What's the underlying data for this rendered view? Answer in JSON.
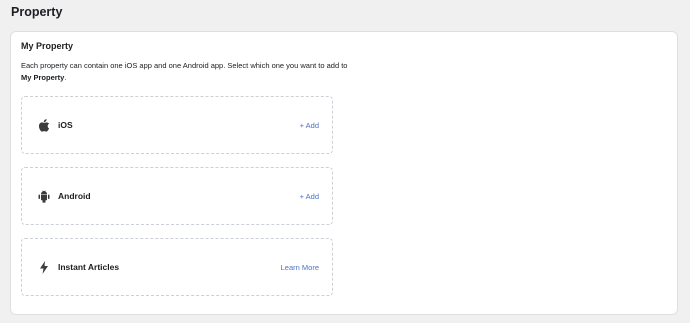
{
  "page": {
    "title": "Property"
  },
  "card": {
    "title": "My Property",
    "description_prefix": "Each property can contain one iOS app and one Android app. Select which one you want to add to ",
    "description_bold": "My Property",
    "description_suffix": "."
  },
  "platforms": [
    {
      "label": "iOS",
      "icon": "apple-icon",
      "action": "+ Add"
    },
    {
      "label": "Android",
      "icon": "android-icon",
      "action": "+ Add"
    },
    {
      "label": "Instant Articles",
      "icon": "lightning-icon",
      "action": "Learn More"
    }
  ],
  "colors": {
    "accent": "#4b72c2",
    "background": "#f0f0f0",
    "card": "#ffffff",
    "border": "#ccd0d5"
  }
}
